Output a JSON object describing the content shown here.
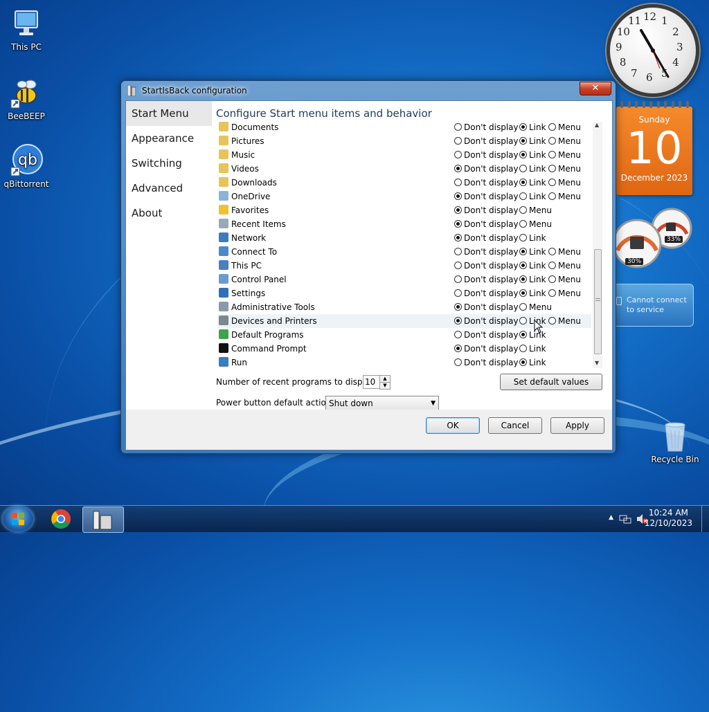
{
  "desktop": {
    "icons": [
      {
        "label": "This PC"
      },
      {
        "label": "BeeBEEP"
      },
      {
        "label": "qBittorrent"
      },
      {
        "label": "Recycle Bin"
      }
    ]
  },
  "gadgets": {
    "calendar": {
      "weekday": "Sunday",
      "day": "10",
      "month_year": "December 2023"
    },
    "gauges": {
      "cpu": "30%",
      "memory": "33%"
    },
    "weather": {
      "message": "Cannot connect to service"
    },
    "clock_numbers": [
      "12",
      "1",
      "2",
      "3",
      "4",
      "5",
      "6",
      "7",
      "8",
      "9",
      "10",
      "11"
    ]
  },
  "window": {
    "title": "StartIsBack configuration",
    "close_label": "✕",
    "nav": [
      "Start Menu",
      "Appearance",
      "Switching",
      "Advanced",
      "About"
    ],
    "heading": "Configure Start menu items and behavior",
    "option_labels": {
      "dont": "Don't display",
      "link": "Link",
      "menu": "Menu"
    },
    "items": [
      {
        "label": "Documents",
        "icon": "folder-icon",
        "options": [
          "dont",
          "link",
          "menu"
        ],
        "selected": "link"
      },
      {
        "label": "Pictures",
        "icon": "folder-icon",
        "options": [
          "dont",
          "link",
          "menu"
        ],
        "selected": "link"
      },
      {
        "label": "Music",
        "icon": "folder-icon",
        "options": [
          "dont",
          "link",
          "menu"
        ],
        "selected": "link"
      },
      {
        "label": "Videos",
        "icon": "folder-icon",
        "options": [
          "dont",
          "link",
          "menu"
        ],
        "selected": "dont"
      },
      {
        "label": "Downloads",
        "icon": "folder-icon",
        "options": [
          "dont",
          "link",
          "menu"
        ],
        "selected": "link"
      },
      {
        "label": "OneDrive",
        "icon": "onedrive-icon",
        "options": [
          "dont",
          "link",
          "menu"
        ],
        "selected": "dont"
      },
      {
        "label": "Favorites",
        "icon": "star-icon",
        "options": [
          "dont",
          "menu"
        ],
        "selected": "dont"
      },
      {
        "label": "Recent Items",
        "icon": "recent-icon",
        "options": [
          "dont",
          "menu"
        ],
        "selected": "dont"
      },
      {
        "label": "Network",
        "icon": "network-icon",
        "options": [
          "dont",
          "link"
        ],
        "selected": "dont"
      },
      {
        "label": "Connect To",
        "icon": "connect-icon",
        "options": [
          "dont",
          "link",
          "menu"
        ],
        "selected": "link"
      },
      {
        "label": "This PC",
        "icon": "computer-icon",
        "options": [
          "dont",
          "link",
          "menu"
        ],
        "selected": "link"
      },
      {
        "label": "Control Panel",
        "icon": "control-panel-icon",
        "options": [
          "dont",
          "link",
          "menu"
        ],
        "selected": "link"
      },
      {
        "label": "Settings",
        "icon": "gear-icon",
        "options": [
          "dont",
          "link",
          "menu"
        ],
        "selected": "link"
      },
      {
        "label": "Administrative Tools",
        "icon": "admin-tools-icon",
        "options": [
          "dont",
          "menu"
        ],
        "selected": "dont"
      },
      {
        "label": "Devices and Printers",
        "icon": "printer-icon",
        "options": [
          "dont",
          "link",
          "menu"
        ],
        "selected": "dont"
      },
      {
        "label": "Default Programs",
        "icon": "default-programs-icon",
        "options": [
          "dont",
          "link"
        ],
        "selected": "link"
      },
      {
        "label": "Command Prompt",
        "icon": "cmd-icon",
        "options": [
          "dont",
          "link"
        ],
        "selected": "dont"
      },
      {
        "label": "Run",
        "icon": "run-icon",
        "options": [
          "dont",
          "link"
        ],
        "selected": "link"
      }
    ],
    "recent_label": "Number of recent programs to display:",
    "recent_value": "10",
    "set_defaults_label": "Set default values",
    "power_label": "Power button default action:",
    "power_value": "Shut down",
    "ok_label": "OK",
    "cancel_label": "Cancel",
    "apply_label": "Apply"
  },
  "taskbar": {
    "time": "10:24 AM",
    "date": "12/10/2023"
  }
}
